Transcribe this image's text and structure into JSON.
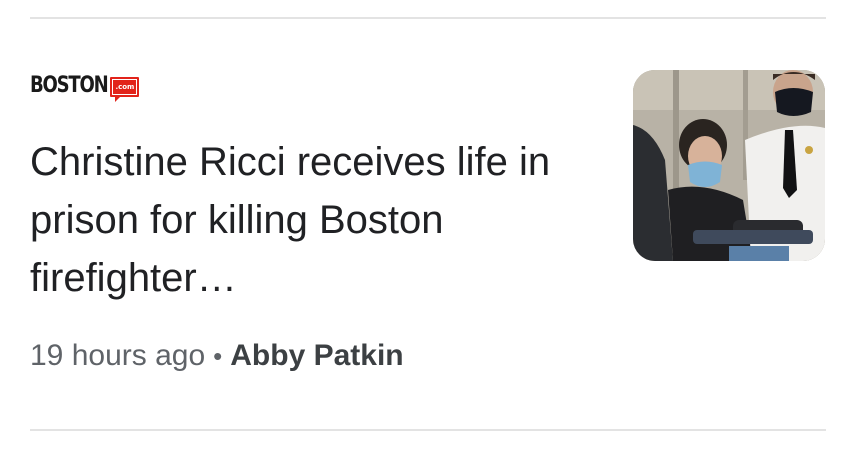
{
  "article": {
    "source_name": "BOSTON",
    "source_domain": ".com",
    "headline": "Christine Ricci receives life in prison for killing Boston firefighter…",
    "time": "19 hours ago",
    "separator": "•",
    "author": "Abby Patkin",
    "thumbnail_icon": "news-photo-thumbnail"
  },
  "colors": {
    "brand_red": "#e2231a",
    "headline_text": "#202124",
    "meta_text": "#5f6368",
    "divider": "#e3e3e3"
  }
}
